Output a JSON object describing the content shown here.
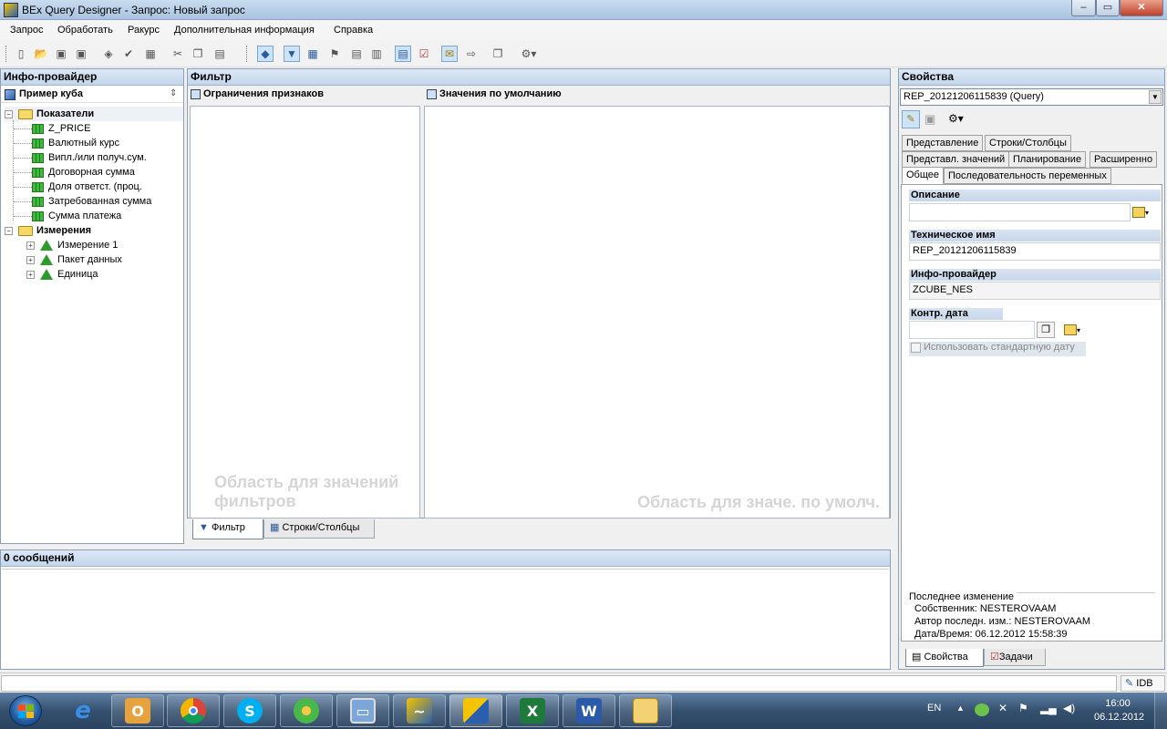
{
  "window": {
    "title": "BEx Query Designer - Запрос: Новый запрос"
  },
  "menu": [
    "Запрос",
    "Обработать",
    "Ракурс",
    "Дополнительная информация",
    "Справка"
  ],
  "infoprovider": {
    "header": "Инфо-провайдер",
    "cube": "Пример куба",
    "folders": {
      "key_figures": "Показатели",
      "dimensions": "Измерения"
    },
    "key_figures": [
      "Z_PRICE",
      "Валютный курс",
      "Випл./или получ.сум.",
      "Договорная сумма",
      "Доля ответст. (проц.",
      "Затребованная сумма",
      "Сумма платежа"
    ],
    "dimensions": [
      "Измерение 1",
      "Пакет данных",
      "Единица"
    ]
  },
  "filter": {
    "header": "Фильтр",
    "restrictions_label": "Ограничения признаков",
    "defaults_label": "Значения по умолчанию",
    "restrictions_placeholder_1": "Область для значений",
    "restrictions_placeholder_2": "фильтров",
    "defaults_placeholder": "Область для значе. по умолч.",
    "tabs": [
      "Фильтр",
      "Строки/Столбцы"
    ]
  },
  "messages": {
    "header": "0 сообщений"
  },
  "properties": {
    "header": "Свойства",
    "selected_object": "REP_20121206115839 (Query)",
    "tabs_row1": [
      "Представление",
      "Строки/Столбцы"
    ],
    "tabs_row2": [
      "Представл. значений",
      "Планирование",
      "Расширенно"
    ],
    "tabs_row3": [
      "Общее",
      "Последовательность переменных"
    ],
    "description_label": "Описание",
    "description_value": "",
    "technical_name_label": "Техническое имя",
    "technical_name_value": "REP_20121206115839",
    "infoprovider_label": "Инфо-провайдер",
    "infoprovider_value": "ZCUBE_NES",
    "key_date_label": "Контр. дата",
    "key_date_value": "",
    "use_default_date": "Использовать стандартную дату",
    "last_change_title": "Последнее изменение",
    "owner": "Собственник: NESTEROVAAM",
    "last_author": "Автор последн. изм.: NESTEROVAAM",
    "datetime": "Дата/Время: 06.12.2012 15:58:39",
    "bottom_tabs": [
      "Свойства",
      "Задачи"
    ]
  },
  "statusbar": {
    "system": "IDB"
  },
  "taskbar": {
    "language": "EN",
    "time": "16:00",
    "date": "06.12.2012",
    "apps": [
      "explorer-ie",
      "outlook",
      "chrome",
      "skype",
      "icq",
      "remote-desktop",
      "sap-logon",
      "bex-designer",
      "excel",
      "word",
      "folder"
    ]
  }
}
